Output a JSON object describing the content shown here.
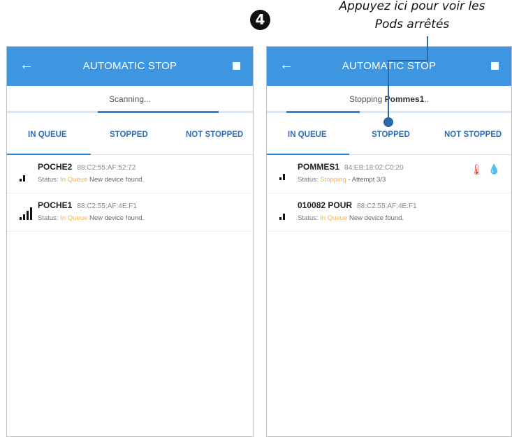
{
  "annotation": {
    "step_number": "4",
    "callout_line1": "Appuyez ici pour voir les",
    "callout_line2": "Pods arrêtés"
  },
  "colors": {
    "appbar": "#3e95e0",
    "tab_text": "#2f6fb7",
    "queue_status": "#f2b24d"
  },
  "screen1": {
    "title": "AUTOMATIC STOP",
    "status": "Scanning...",
    "progress_fraction": 0.49,
    "tabs": [
      "IN QUEUE",
      "STOPPED",
      "NOT STOPPED"
    ],
    "devices": [
      {
        "name": "POCHE2",
        "mac": "88:C2:55:AF:52:72",
        "status_label": "Status:",
        "status": "In Queue",
        "message": "New device found.",
        "signal_bars": 2
      },
      {
        "name": "POCHE1",
        "mac": "88:C2:55:AF:4E:F1",
        "status_label": "Status:",
        "status": "In Queue",
        "message": "New device found.",
        "signal_bars": 4
      }
    ]
  },
  "screen2": {
    "title": "AUTOMATIC STOP",
    "status_prefix": "Stopping ",
    "status_name": "Pommes1",
    "status_suffix": "..",
    "progress_fraction": 0.3,
    "tabs": [
      "IN QUEUE",
      "STOPPED",
      "NOT STOPPED"
    ],
    "devices": [
      {
        "name": "POMMES1",
        "mac": "84:EB:18:02:C0:20",
        "status_label": "Status:",
        "status": "Stopping",
        "message": "- Attempt 3/3",
        "signal_bars": 2
      },
      {
        "name": "010082 POUR",
        "mac": "88:C2:55:AF:4E:F1",
        "status_label": "Status:",
        "status": "In Queue",
        "message": "New device found.",
        "signal_bars": 2
      }
    ]
  }
}
